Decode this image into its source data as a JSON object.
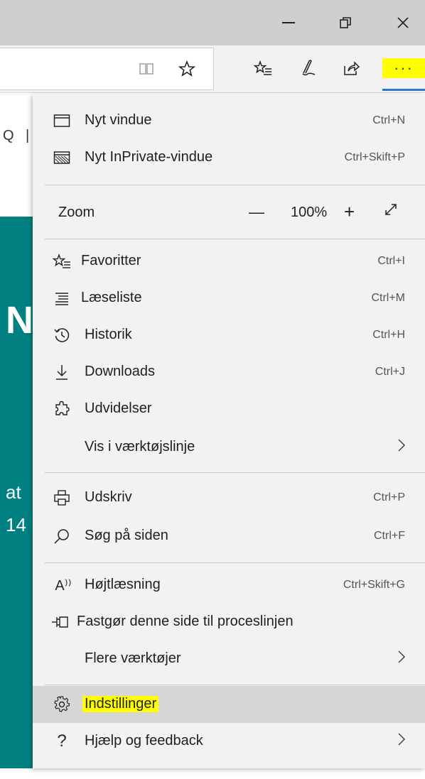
{
  "window": {
    "minimize_label": "—",
    "restore_label": "⧉",
    "close_label": "✕"
  },
  "toolbar": {
    "reading_view_icon": "reading-view-icon",
    "favorite_star_icon": "star-icon",
    "favorites_hub_icon": "favorites-hub-icon",
    "notes_icon": "pen-icon",
    "share_icon": "share-icon",
    "more_label": "···"
  },
  "page": {
    "fragment_q": "Q",
    "fragment_bar": "|",
    "fragment_n": "N",
    "fragment_at": "at",
    "fragment_14": "14"
  },
  "menu": {
    "new_window": {
      "label": "Nyt vindue",
      "shortcut": "Ctrl+N"
    },
    "new_inprivate": {
      "label": "Nyt InPrivate-vindue",
      "shortcut": "Ctrl+Skift+P"
    },
    "zoom": {
      "label": "Zoom",
      "minus": "—",
      "value": "100%",
      "plus": "+",
      "fullscreen": "⤢"
    },
    "favorites": {
      "label": "Favoritter",
      "shortcut": "Ctrl+I"
    },
    "reading_list": {
      "label": "Læseliste",
      "shortcut": "Ctrl+M"
    },
    "history": {
      "label": "Historik",
      "shortcut": "Ctrl+H"
    },
    "downloads": {
      "label": "Downloads",
      "shortcut": "Ctrl+J"
    },
    "extensions": {
      "label": "Udvidelser"
    },
    "show_in_toolbar": {
      "label": "Vis i værktøjslinje",
      "chevron": "›"
    },
    "print": {
      "label": "Udskriv",
      "shortcut": "Ctrl+P"
    },
    "find": {
      "label": "Søg på siden",
      "shortcut": "Ctrl+F"
    },
    "read_aloud": {
      "label": "Højtlæsning",
      "icon_text": "A⁾⁾",
      "shortcut": "Ctrl+Skift+G"
    },
    "pin_taskbar": {
      "label": "Fastgør denne side til proceslinjen"
    },
    "more_tools": {
      "label": "Flere værktøjer",
      "chevron": "›"
    },
    "settings": {
      "label": "Indstillinger"
    },
    "help": {
      "label": "Hjælp og feedback",
      "icon_text": "?",
      "chevron": "›"
    }
  },
  "colors": {
    "highlight": "#ffff00",
    "teal": "#008080",
    "accent": "#2b78d6"
  }
}
